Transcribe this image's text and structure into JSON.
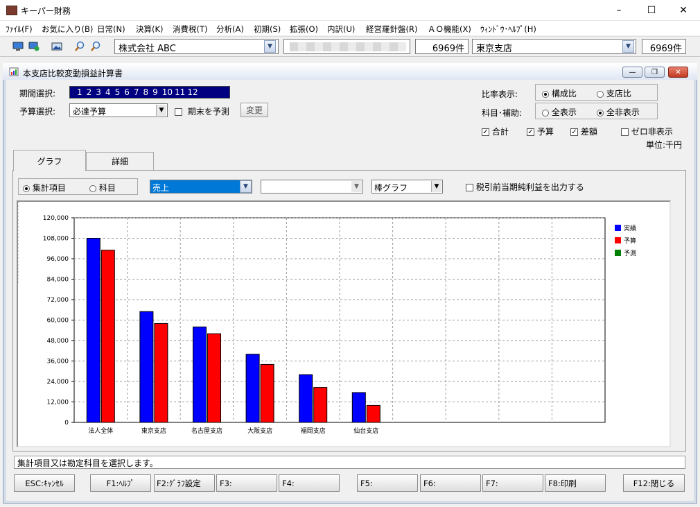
{
  "window": {
    "title": "キーパー財務"
  },
  "menu": [
    "ﾌｧｲﾙ(F)",
    "お気に入り(B)",
    "日常(N)",
    "決算(K)",
    "消費税(T)",
    "分析(A)",
    "初期(S)",
    "拡張(O)",
    "内訳(U)",
    "経営羅針盤(R)",
    "ＡＯ機能(X)",
    "ｳｨﾝﾄﾞｳ･ﾍﾙﾌﾟ(H)"
  ],
  "toolbar": {
    "company": "株式会社 ABC",
    "company_count": "6969件",
    "branch": "東京支店",
    "branch_count": "6969件"
  },
  "inner": {
    "title": "本支店比較変動損益計算書"
  },
  "form": {
    "period_label": "期間選択:",
    "months": [
      "1",
      "2",
      "3",
      "4",
      "5",
      "6",
      "7",
      "8",
      "9",
      "10",
      "11",
      "12"
    ],
    "budget_label": "予算選択:",
    "budget_value": "必達予算",
    "forecast_label": "期末を予測",
    "change_button": "変更",
    "ratio_label": "比率表示:",
    "ratio_options": [
      "構成比",
      "支店比"
    ],
    "account_label": "科目･補助:",
    "account_options": [
      "全表示",
      "全非表示"
    ],
    "checks": [
      "合計",
      "予算",
      "差額",
      "ゼロ非表示"
    ],
    "unit": "単位:千円"
  },
  "tabs": [
    "グラフ",
    "詳細"
  ],
  "graph_controls": {
    "mode_options": [
      "集計項目",
      "科目"
    ],
    "item_value": "売上",
    "second_value": "",
    "graph_type": "棒グラフ",
    "pretax_label": "税引前当期純利益を出力する"
  },
  "chart_data": {
    "type": "bar",
    "categories": [
      "法人全体",
      "東京支店",
      "名古屋支店",
      "大阪支店",
      "福岡支店",
      "仙台支店"
    ],
    "series": [
      {
        "name": "実績",
        "values": [
          108000,
          65000,
          56000,
          40000,
          28000,
          17500
        ],
        "color": "#0000ff"
      },
      {
        "name": "予算",
        "values": [
          101000,
          58000,
          52000,
          34000,
          20500,
          10000
        ],
        "color": "#ff0000"
      },
      {
        "name": "予測",
        "values": [],
        "color": "#008000"
      }
    ],
    "ylim": [
      0,
      120000
    ],
    "yticks": [
      "0",
      "12,000",
      "24,000",
      "36,000",
      "48,000",
      "60,000",
      "72,000",
      "84,000",
      "96,000",
      "108,000",
      "120,000"
    ],
    "grid": true,
    "legend": "top-right"
  },
  "status": "集計項目又は勘定科目を選択します。",
  "fkeys": [
    "ESC:ｷｬﾝｾﾙ",
    "F1:ﾍﾙﾌﾟ",
    "F2:ｸﾞﾗﾌ設定",
    "F3:",
    "F4:",
    "F5:",
    "F6:",
    "F7:",
    "F8:印刷",
    "F12:閉じる"
  ]
}
